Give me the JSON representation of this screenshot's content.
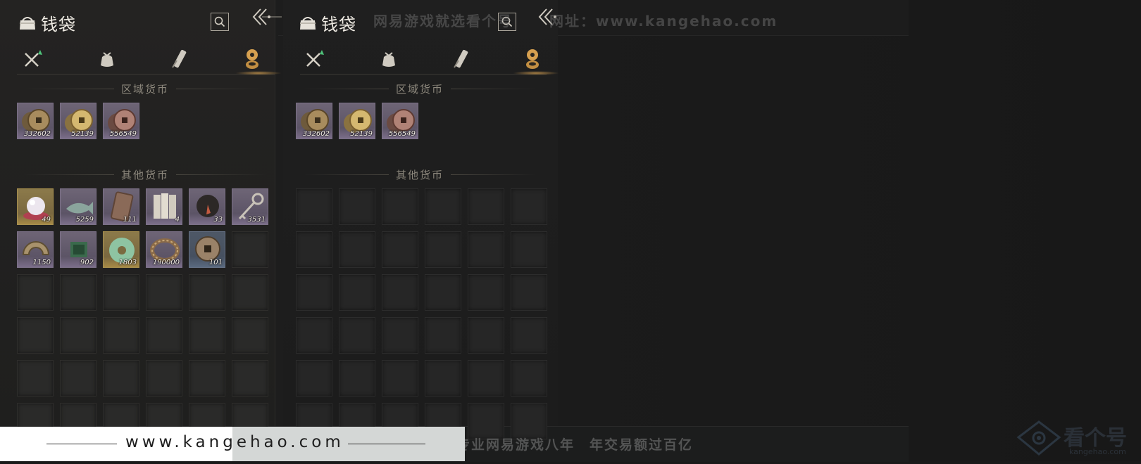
{
  "colors": {
    "accent_gold": "#d6a050",
    "quality_purple": "#6e6576",
    "quality_gold": "#8c7a4a",
    "quality_blue": "#4e5866"
  },
  "panel_left": {
    "title": "钱袋",
    "tabs": [
      {
        "icon": "sword-icon"
      },
      {
        "icon": "pouch-icon"
      },
      {
        "icon": "scroll-icon"
      },
      {
        "icon": "coin-stack-icon"
      }
    ],
    "regional_title": "区域货币",
    "regional": [
      {
        "icon": "copper-coin-icon",
        "count": "332602",
        "quality": "purple"
      },
      {
        "icon": "gold-coin-icon",
        "count": "52139",
        "quality": "purple"
      },
      {
        "icon": "red-coin-icon",
        "count": "556549",
        "quality": "purple"
      }
    ],
    "other_title": "其他货币",
    "other": [
      {
        "icon": "pearl-icon",
        "count": "49",
        "quality": "gold"
      },
      {
        "icon": "fish-token-icon",
        "count": "5259",
        "quality": "purple"
      },
      {
        "icon": "talisman-icon",
        "count": "111",
        "quality": "purple"
      },
      {
        "icon": "paper-notes-icon",
        "count": "4",
        "quality": "purple"
      },
      {
        "icon": "dark-orb-icon",
        "count": "33",
        "quality": "purple"
      },
      {
        "icon": "key-icon",
        "count": "3531",
        "quality": "purple"
      },
      {
        "icon": "half-coin-icon",
        "count": "1150",
        "quality": "purple"
      },
      {
        "icon": "jade-token-icon",
        "count": "902",
        "quality": "purple"
      },
      {
        "icon": "jade-disc-icon",
        "count": "1803",
        "quality": "gold"
      },
      {
        "icon": "bracelet-icon",
        "count": "190000",
        "quality": "purple"
      },
      {
        "icon": "ancient-coin-icon",
        "count": "101",
        "quality": "blue"
      }
    ]
  },
  "panel_right": {
    "title": "钱袋",
    "regional_title": "区域货币",
    "regional": [
      {
        "icon": "copper-coin-icon",
        "count": "332602"
      },
      {
        "icon": "gold-coin-icon",
        "count": "52139"
      },
      {
        "icon": "red-coin-icon",
        "count": "556549"
      }
    ],
    "other_title": "其他货币"
  },
  "watermarks": {
    "top": "网易游戏就选看个号",
    "top_url": "网址：www.kangehao.com",
    "bottom": "看个号专业网易游戏八年　年交易额过百亿",
    "logo_text": "看个号",
    "logo_url": "kangehao.com",
    "footer_url": "www.kangehao.com"
  }
}
